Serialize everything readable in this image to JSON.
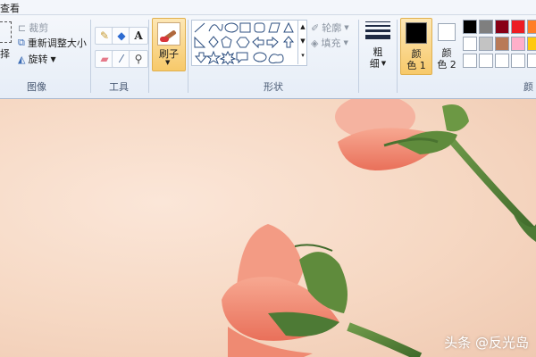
{
  "tabs": {
    "view": "查看"
  },
  "image_group": {
    "select_label": "择",
    "crop": "裁剪",
    "resize": "重新调整大小",
    "rotate": "旋转",
    "group_label": "图像"
  },
  "tools_group": {
    "group_label": "工具",
    "text_tool": "A"
  },
  "brushes": {
    "label": "刷子"
  },
  "shapes_group": {
    "outline": "轮廓",
    "fill": "填充",
    "group_label": "形状"
  },
  "size": {
    "label_line1": "粗",
    "label_line2": "细"
  },
  "colors_group": {
    "color1_line1": "颜",
    "color1_line2": "色 1",
    "color2_line1": "颜",
    "color2_line2": "色 2",
    "group_label": "颜",
    "color1_value": "#000000",
    "color2_value": "#ffffff",
    "palette_row1": [
      "#000000",
      "#7f7f7f",
      "#880015",
      "#ed1c24",
      "#ff7f27"
    ],
    "palette_row2": [
      "#ffffff",
      "#c3c3c3",
      "#b97a57",
      "#ffaec9",
      "#ffc90e"
    ],
    "palette_row3": [
      "#ffffff",
      "#ffffff",
      "#ffffff",
      "#ffffff",
      "#ffffff"
    ]
  },
  "watermark": {
    "text": "头条 @反光岛"
  }
}
